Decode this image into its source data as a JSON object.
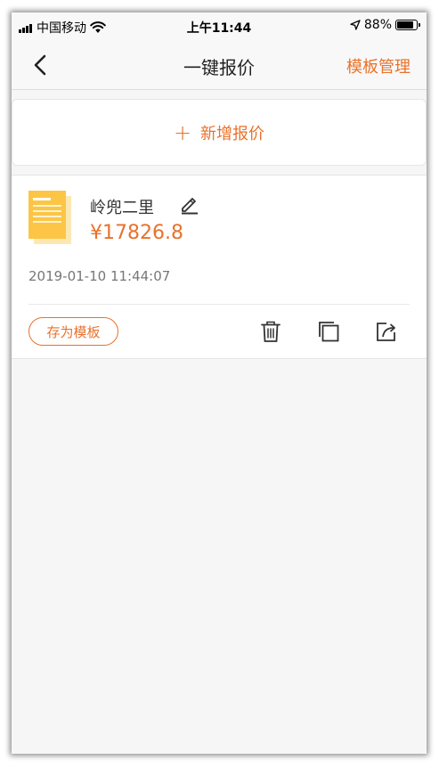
{
  "status_bar": {
    "carrier": "中国移动",
    "time": "上午11:44",
    "battery_percent": "88%",
    "battery_level": 0.88
  },
  "nav": {
    "title": "一键报价",
    "right_action": "模板管理"
  },
  "add_quote": {
    "label": "新增报价"
  },
  "quotes": [
    {
      "name": "岭兜二里",
      "price": "¥17826.8",
      "date": "2019-01-10 11:44:07",
      "save_template_label": "存为模板"
    }
  ],
  "colors": {
    "accent": "#e8722b",
    "background": "#f6f6f6",
    "doc_icon": "#fcc545"
  }
}
